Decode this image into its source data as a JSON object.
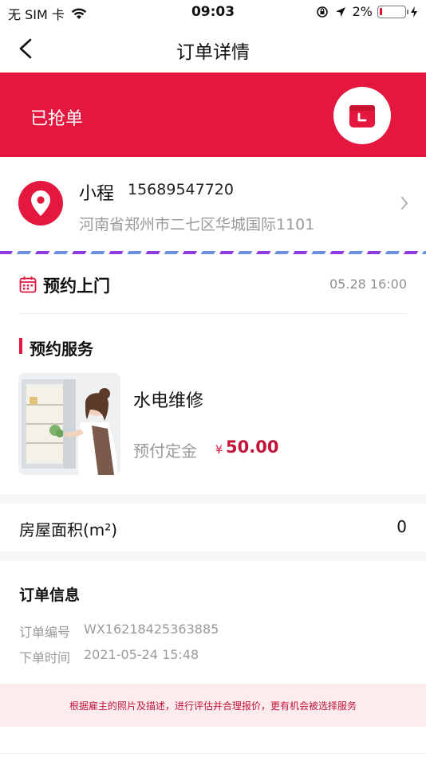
{
  "status_bar": {
    "carrier": "无 SIM 卡",
    "time": "09:03",
    "battery_percent": "2%",
    "battery_level": 0.02
  },
  "nav": {
    "title": "订单详情",
    "back_icon": "chevron-left-icon"
  },
  "order_status": {
    "label": "已抢单",
    "icon": "box-icon",
    "color": "#e4173e"
  },
  "address": {
    "name": "小程",
    "phone": "15689547720",
    "address": "河南省郑州市二七区华城国际1101",
    "icon": "location-pin-icon"
  },
  "appointment": {
    "label": "预约上门",
    "time": "05.28 16:00",
    "icon": "calendar-icon"
  },
  "service": {
    "section_title": "预约服务",
    "name": "水电维修",
    "deposit_label": "预付定金",
    "currency": "¥",
    "deposit_amount": "50.00"
  },
  "house_area": {
    "label": "房屋面积(m²)",
    "value": "0"
  },
  "order_info": {
    "title": "订单信息",
    "number_label": "订单编号",
    "number_value": "WX16218425363885",
    "time_label": "下单时间",
    "time_value": "2021-05-24 15:48"
  },
  "notice": {
    "text": "根据雇主的照片及描述，进行评估并合理报价，更有机会被选择服务"
  },
  "colors": {
    "accent": "#e4173e",
    "price": "#c2153a",
    "muted_text": "#9a9a9a",
    "notice_bg": "#fdecee"
  }
}
